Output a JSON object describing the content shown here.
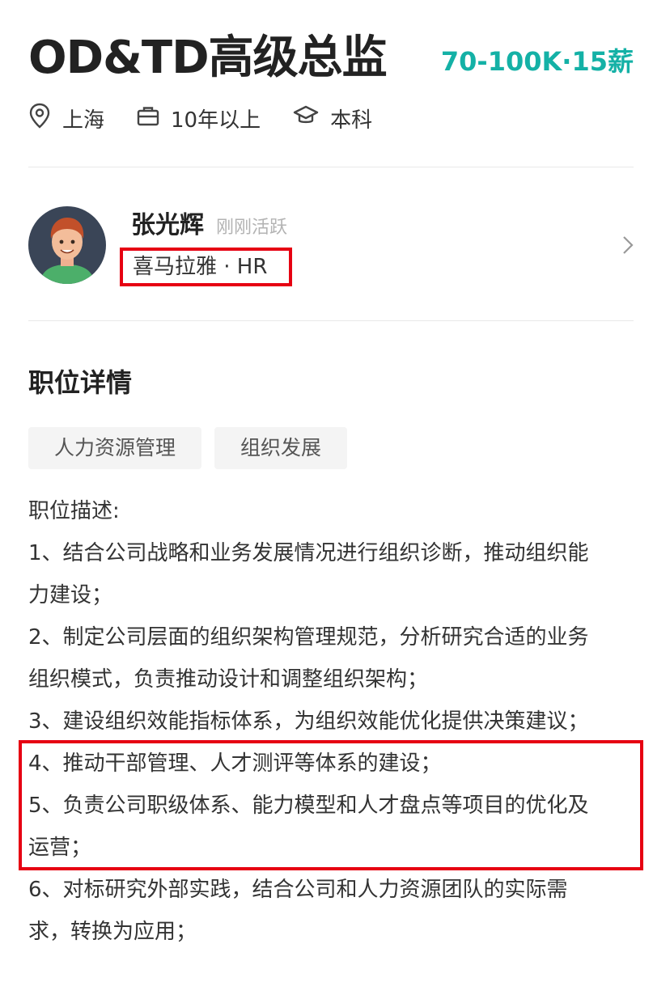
{
  "job": {
    "title": "OD&TD高级总监",
    "salary": "70-100K·15薪",
    "location": "上海",
    "experience": "10年以上",
    "education": "本科"
  },
  "recruiter": {
    "name": "张光辉",
    "status": "刚刚活跃",
    "company_role": "喜马拉雅 · HR"
  },
  "details": {
    "section_title": "职位详情",
    "tags": [
      "人力资源管理",
      "组织发展"
    ],
    "desc_heading": "职位描述:",
    "items": [
      "1、结合公司战略和业务发展情况进行组织诊断，推动组织能",
      "力建设；",
      "2、制定公司层面的组织架构管理规范，分析研究合适的业务",
      "组织模式，负责推动设计和调整组织架构；",
      "3、建设组织效能指标体系，为组织效能优化提供决策建议；",
      "4、推动干部管理、人才测评等体系的建设；",
      "5、负责公司职级体系、能力模型和人才盘点等项目的优化及",
      "运营；",
      "6、对标研究外部实践，结合公司和人力资源团队的实际需",
      "求，转换为应用；"
    ]
  },
  "colors": {
    "salary": "#14b1a6",
    "highlight": "#e60012"
  },
  "icons": [
    "location-pin-icon",
    "briefcase-icon",
    "graduation-cap-icon",
    "chevron-right-icon"
  ]
}
